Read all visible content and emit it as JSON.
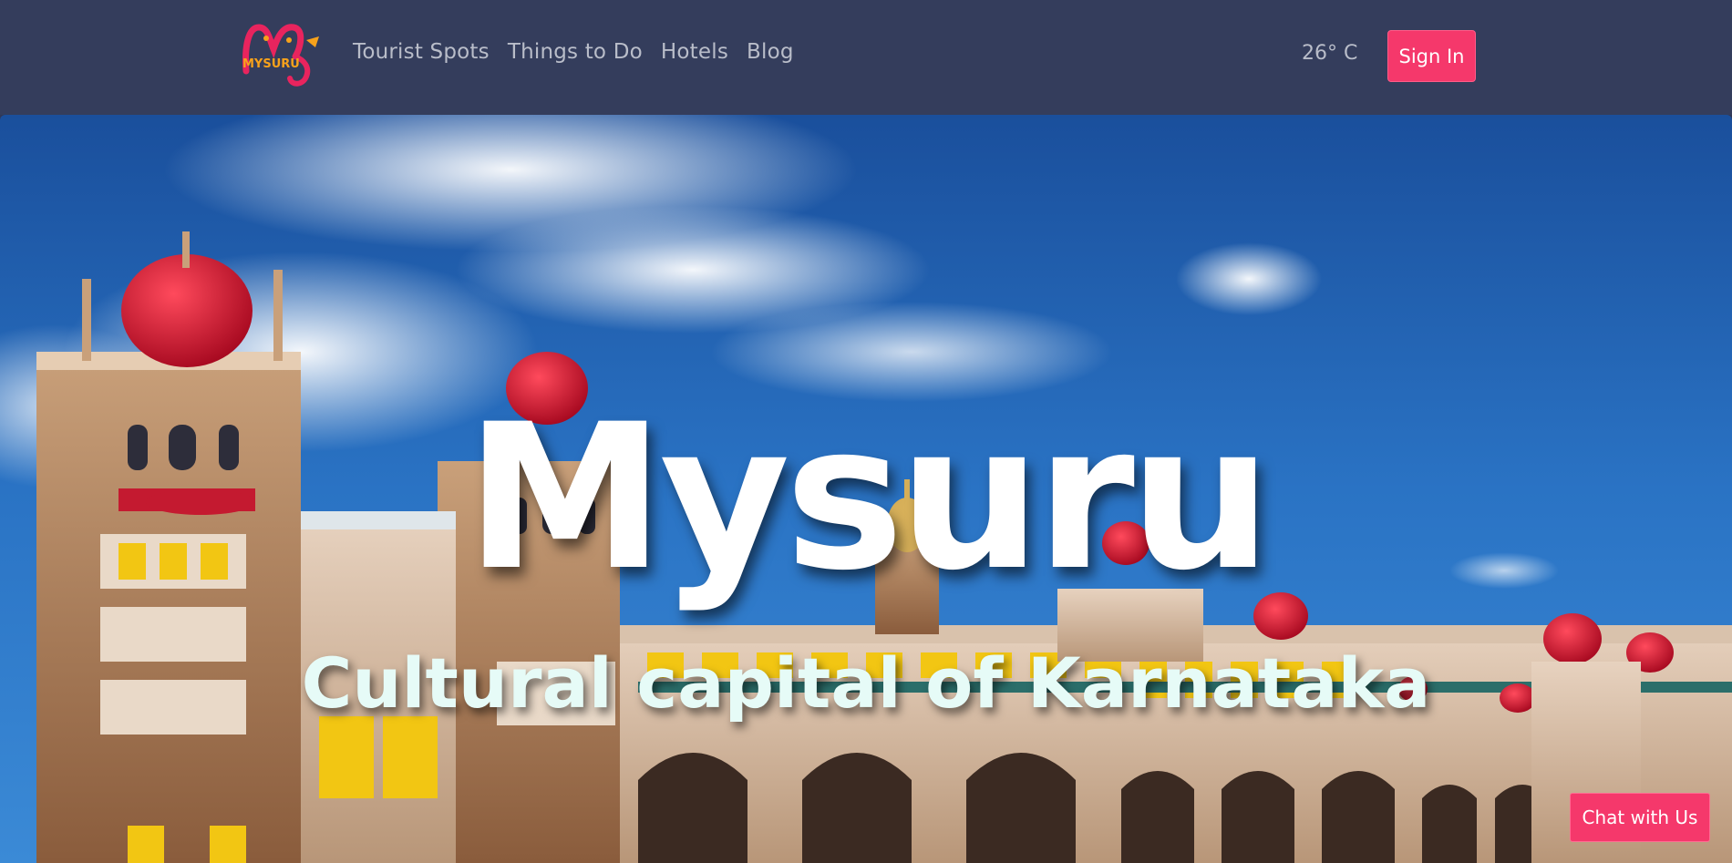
{
  "brand": {
    "logo_text": "MYSURU"
  },
  "nav": {
    "links": [
      {
        "label": "Tourist Spots"
      },
      {
        "label": "Things to Do"
      },
      {
        "label": "Hotels"
      },
      {
        "label": "Blog"
      }
    ],
    "temperature": "26° C",
    "sign_in_label": "Sign In"
  },
  "hero": {
    "title": "Mysuru",
    "subtitle": "Cultural capital of Karnataka"
  },
  "chat": {
    "label": "Chat with Us"
  },
  "colors": {
    "navbar_bg": "#343d5c",
    "accent": "#f5386b",
    "nav_text": "#b9bdc9",
    "sky": "#1d5ba8"
  }
}
